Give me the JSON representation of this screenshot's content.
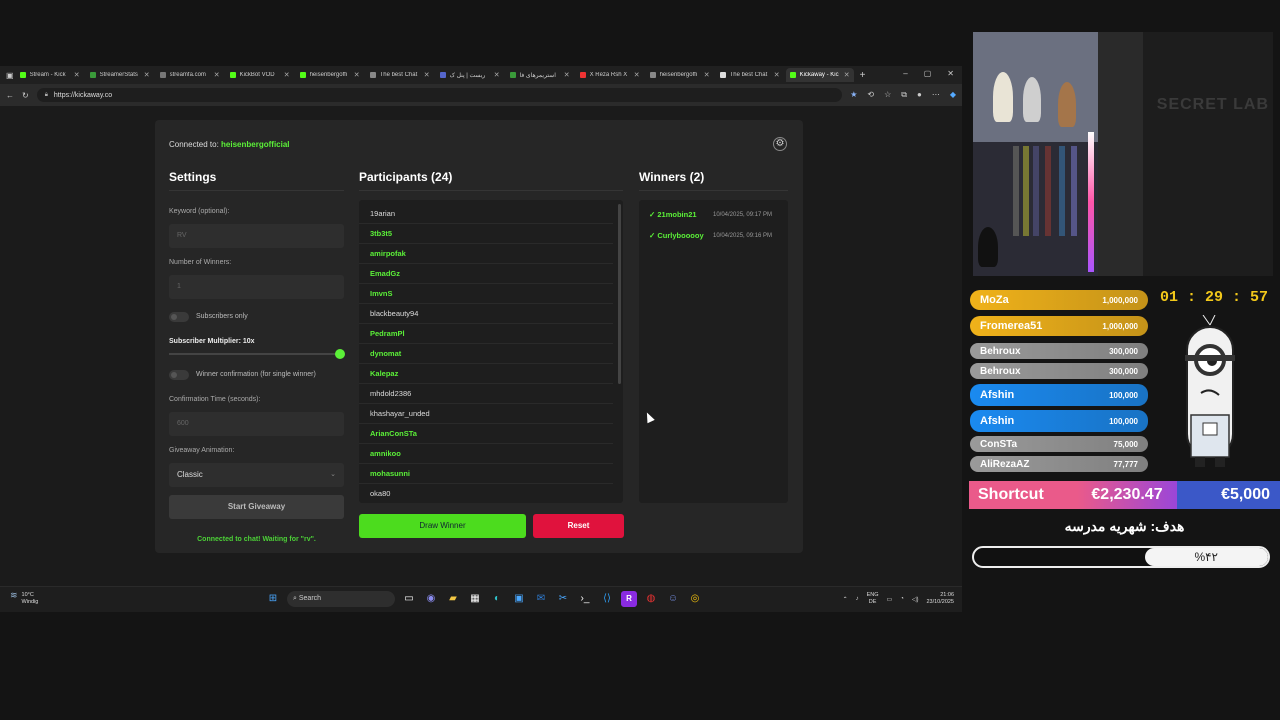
{
  "browser": {
    "tabs": [
      {
        "label": "Stream - Kick",
        "color": "#53fc18"
      },
      {
        "label": "StreamerStats",
        "color": "#3a9a3a"
      },
      {
        "label": "streamfa.com",
        "color": "#777777"
      },
      {
        "label": "KickBot VOD",
        "color": "#53fc18"
      },
      {
        "label": "heisenbergoffi",
        "color": "#53fc18"
      },
      {
        "label": "The best Chat",
        "color": "#888888"
      },
      {
        "label": "ریست | پنل ک",
        "color": "#5566cc"
      },
      {
        "label": "استریمرهای ‌فا",
        "color": "#3a9a3a"
      },
      {
        "label": "X Reza Rsh X",
        "color": "#e33"
      },
      {
        "label": "heisenbergoffi",
        "color": "#888888"
      },
      {
        "label": "The best Chat",
        "color": "#dddddd"
      },
      {
        "label": "Kickaway - Kic",
        "color": "#53fc18",
        "active": true
      }
    ],
    "new_tab": "+",
    "url": "https://kickaway.co"
  },
  "app": {
    "connected_label": "Connected to:",
    "channel": "heisenbergofficial",
    "settings": {
      "title": "Settings",
      "keyword_label": "Keyword (optional):",
      "keyword_value": "RV",
      "winners_label": "Number of Winners:",
      "winners_value": "1",
      "subs_only_label": "Subscribers only",
      "multiplier_label": "Subscriber Multiplier: 10x",
      "multiplier_level": 1.0,
      "confirmation_label": "Winner confirmation (for single winner)",
      "confirm_time_label": "Confirmation Time (seconds):",
      "confirm_time_value": "600",
      "animation_label": "Giveaway Animation:",
      "animation_value": "Classic",
      "start_label": "Start Giveaway",
      "status": "Connected to chat! Waiting for \"rv\"."
    },
    "participants": {
      "title": "Participants (24)",
      "items": [
        {
          "name": "19arian",
          "sub": false
        },
        {
          "name": "3tb3t5",
          "sub": true
        },
        {
          "name": "amirpofak",
          "sub": true
        },
        {
          "name": "EmadGz",
          "sub": true
        },
        {
          "name": "ImvnS",
          "sub": true
        },
        {
          "name": "blackbeauty94",
          "sub": false
        },
        {
          "name": "PedramPl",
          "sub": true
        },
        {
          "name": "dynomat",
          "sub": true
        },
        {
          "name": "Kalepaz",
          "sub": true
        },
        {
          "name": "mhdold2386",
          "sub": false
        },
        {
          "name": "khashayar_unded",
          "sub": false
        },
        {
          "name": "ArianConSTa",
          "sub": true
        },
        {
          "name": "amnikoo",
          "sub": true
        },
        {
          "name": "mohasunni",
          "sub": true
        },
        {
          "name": "oka80",
          "sub": false
        }
      ],
      "draw_label": "Draw Winner",
      "reset_label": "Reset"
    },
    "winners": {
      "title": "Winners (2)",
      "items": [
        {
          "name": "✓ 21mobin21",
          "time": "10/04/2025, 09:17 PM"
        },
        {
          "name": "✓ Curlybooooy",
          "time": "10/04/2025, 09:16 PM"
        }
      ]
    }
  },
  "taskbar": {
    "temp": "10°C",
    "weather": "Windig",
    "search": "Search",
    "lang1": "ENG",
    "lang2": "DE",
    "time": "21:06",
    "date": "23/10/2025"
  },
  "overlay": {
    "timer": "01 : 29 : 57",
    "cam_brand": "SECRET LAB",
    "donors": [
      {
        "name": "MoZa",
        "amount": "1,000,000",
        "color": "#f0b21a"
      },
      {
        "name": "Fromerea51",
        "amount": "1,000,000",
        "color": "#f0b21a"
      },
      {
        "name": "Behroux",
        "amount": "300,000",
        "color": "#9a9a9a"
      },
      {
        "name": "Behroux",
        "amount": "300,000",
        "color": "#9a9a9a"
      },
      {
        "name": "Afshin",
        "amount": "100,000",
        "color": "#1a8af0"
      },
      {
        "name": "Afshin",
        "amount": "100,000",
        "color": "#1a8af0"
      },
      {
        "name": "ConSTa",
        "amount": "75,000",
        "color": "#9a9a9a"
      },
      {
        "name": "AliRezaAZ",
        "amount": "77,777",
        "color": "#9a9a9a"
      }
    ],
    "goal": {
      "label": "Shortcut",
      "current": "€2,230.47",
      "target": "€5,000",
      "title": "هدف: شهریه مدرسه",
      "percent_text": "%۴۲",
      "progress": 0.42
    }
  }
}
